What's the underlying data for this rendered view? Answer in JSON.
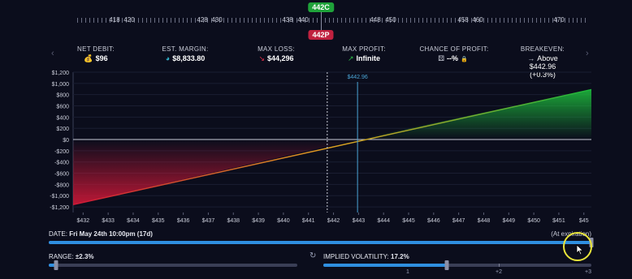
{
  "strikes": {
    "labels": [
      "418",
      "420",
      "428",
      "430",
      "438",
      "440",
      "448",
      "450",
      "458",
      "460",
      "470"
    ],
    "call_badge": "442C",
    "put_badge": "442P"
  },
  "stats": [
    {
      "label": "NET DEBIT:",
      "value": "$96",
      "icon": "coins-icon",
      "glyph": "💰"
    },
    {
      "label": "EST. MARGIN:",
      "value": "$8,833.80",
      "icon": "globe-icon",
      "glyph": "◕"
    },
    {
      "label": "MAX LOSS:",
      "value": "$44,296",
      "icon": "arrow-down-icon",
      "glyph": "↘"
    },
    {
      "label": "MAX PROFIT:",
      "value": "Infinite",
      "icon": "arrow-up-icon",
      "glyph": "↗"
    },
    {
      "label": "CHANCE OF PROFIT:",
      "value": "--%",
      "icon": "dice-icon",
      "glyph": "⚄"
    },
    {
      "label": "BREAKEVEN:",
      "value": "Above $442.96 (+0.3%)",
      "icon": "arrow-right-icon",
      "glyph": "→"
    }
  ],
  "chance_lock_glyph": "🔒",
  "chart_data": {
    "type": "area",
    "x_ticks": [
      "$432",
      "$433",
      "$434",
      "$435",
      "$436",
      "$437",
      "$438",
      "$439",
      "$440",
      "$441",
      "$442",
      "$443",
      "$444",
      "$445",
      "$446",
      "$447",
      "$448",
      "$449",
      "$450",
      "$451",
      "$45"
    ],
    "y_ticks": [
      "$1,200",
      "$1,000",
      "$800",
      "$600",
      "$400",
      "$200",
      "$0",
      "-$200",
      "-$400",
      "-$600",
      "-$800",
      "-$1,000",
      "-$1,200"
    ],
    "xlim": [
      431.6,
      452.3
    ],
    "ylim": [
      -1300,
      1200
    ],
    "series": [
      {
        "x": [
          431.6,
          452.3
        ],
        "y": [
          -1160,
          890
        ]
      }
    ],
    "current_price_label": "$442.96",
    "current_price": 442.96,
    "breakeven": 442.96,
    "dotted_marker": 441.75,
    "colors": {
      "profit": "#1db83c",
      "loss": "#d01838",
      "zero_line": "#c9ccd8",
      "price_line": "#4aa4d4"
    }
  },
  "date_row": {
    "label": "DATE:",
    "value": "Fri May 24th 10:00pm (17d)",
    "right": "(At expiration)",
    "fill": 1.0
  },
  "range": {
    "label": "RANGE:",
    "value": "±2.3%",
    "fill": 0.03
  },
  "iv": {
    "label": "IMPLIED VOLATILITY:",
    "value": "17.2%",
    "fill": 0.46,
    "ticks": [
      "1",
      "+2",
      "+3"
    ]
  },
  "icons": {
    "reset": "reset-icon",
    "cursor": "mouse-cursor-icon",
    "nav_left": "chevron-left-icon",
    "nav_right": "chevron-right-icon"
  }
}
